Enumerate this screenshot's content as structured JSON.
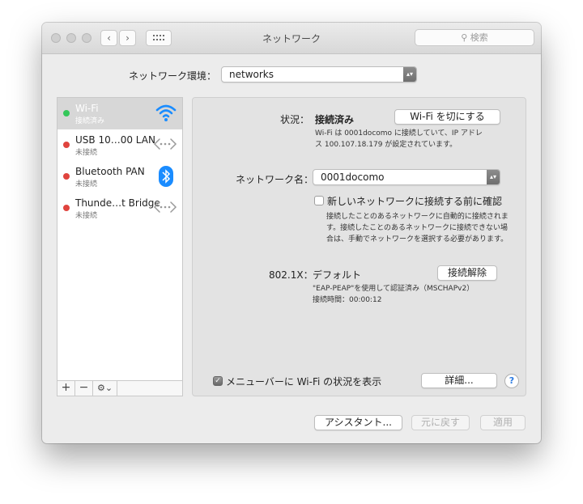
{
  "window": {
    "title": "ネットワーク"
  },
  "search": {
    "placeholder": "検索",
    "icon": "magnifier-icon"
  },
  "location": {
    "label": "ネットワーク環境：",
    "value": "networks"
  },
  "services": [
    {
      "name": "Wi-Fi",
      "status": "接続済み",
      "dot_color": "#34c759",
      "icon": "wifi-icon",
      "selected": true
    },
    {
      "name": "USB 10…00 LAN",
      "status": "未接続",
      "dot_color": "#e0443e",
      "icon": "ethernet-arrows-icon"
    },
    {
      "name": "Bluetooth PAN",
      "status": "未接続",
      "dot_color": "#e0443e",
      "icon": "bluetooth-icon"
    },
    {
      "name": "Thunde…t Bridge",
      "status": "未接続",
      "dot_color": "#e0443e",
      "icon": "ethernet-arrows-icon"
    }
  ],
  "sidebar_controls": {
    "add": "+",
    "remove": "−",
    "gear": "⚙︎⌄"
  },
  "wifi": {
    "status_label": "状況：",
    "status_value": "接続済み",
    "toggle_button": "Wi-Fi を切にする",
    "status_desc_line1": "Wi-Fi は 0001docomo に接続していて、IP アドレ",
    "status_desc_line2": "ス 100.107.18.179 が設定されています。",
    "network_name_label": "ネットワーク名：",
    "network_name_value": "0001docomo",
    "ask_checkbox_label": "新しいネットワークに接続する前に確認",
    "ask_desc_line1": "接続したことのあるネットワークに自動的に接続されま",
    "ask_desc_line2": "す。接続したことのあるネットワークに接続できない場",
    "ask_desc_line3": "合は、手動でネットワークを選択する必要があります。",
    "auth_label": "802.1X：",
    "auth_value": "デフォルト",
    "disconnect_button": "接続解除",
    "auth_desc_line1": "\"EAP-PEAP\"を使用して認証済み（MSCHAPv2）",
    "auth_desc_line2": "接続時間：00:00:12",
    "menubar_checkbox_label": "メニューバーに Wi-Fi の状況を表示",
    "menubar_checked": true,
    "advanced_button": "詳細...",
    "help": "?"
  },
  "footer": {
    "assist": "アシスタント...",
    "revert": "元に戻す",
    "apply": "適用"
  }
}
